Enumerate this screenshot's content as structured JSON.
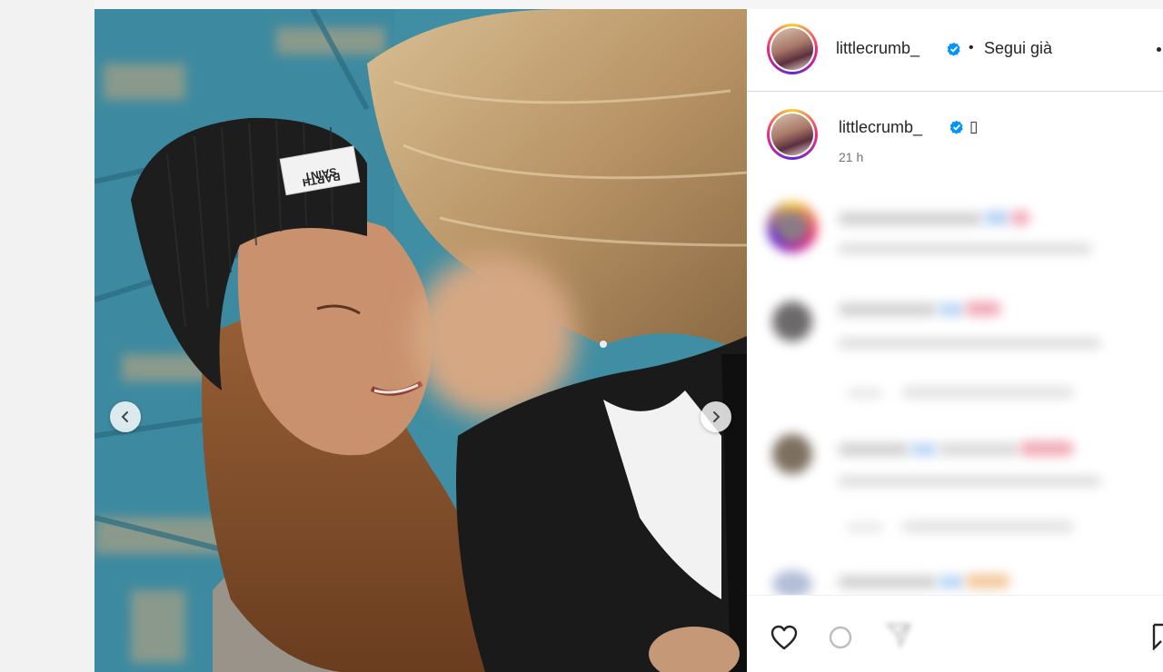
{
  "post": {
    "author": {
      "username": "littlecrumb_",
      "verified": true,
      "follow_label": "Segui già",
      "separator": "•"
    },
    "caption": {
      "username": "littlecrumb_",
      "emoji": "▯",
      "time": "21 h"
    },
    "comments_blurred": true,
    "media": {
      "description_icon": "carousel-photo",
      "prev_icon": "chevron-left-icon",
      "next_icon": "chevron-right-icon"
    },
    "actions": [
      "heart-icon",
      "comment-icon",
      "share-icon",
      "bookmark-icon"
    ]
  },
  "colors": {
    "verified_blue": "#0095f6",
    "text_primary": "#262626",
    "text_secondary": "#737373",
    "divider": "#dbdbdb"
  }
}
